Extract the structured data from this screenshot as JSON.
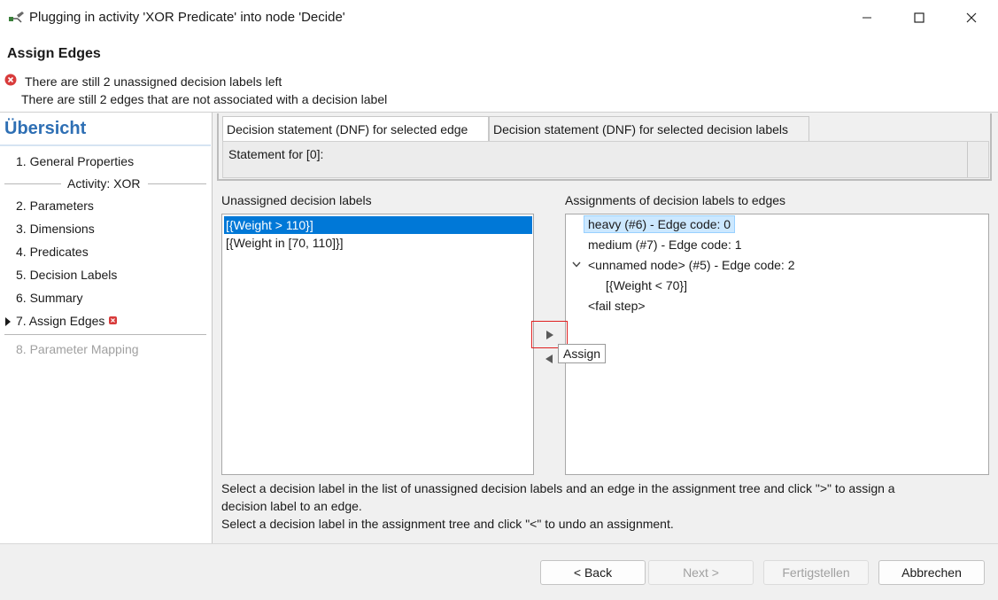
{
  "window": {
    "title": "Plugging in activity 'XOR Predicate' into node 'Decide'",
    "icons": {
      "app": "workflow-plug-icon",
      "minimize": "minimize-icon",
      "maximize": "maximize-icon",
      "close": "close-icon"
    }
  },
  "header": {
    "title": "Assign Edges",
    "messages": [
      "There are still 2 unassigned decision labels left",
      "There are still 2 edges that are not associated with a decision label"
    ],
    "error_color": "#d83b3b"
  },
  "sidebar": {
    "title": "Übersicht",
    "title_color": "#2e6fb4",
    "items": [
      {
        "label": "1. General Properties"
      },
      {
        "label": "2. Parameters"
      },
      {
        "label": "3. Dimensions"
      },
      {
        "label": "4. Predicates"
      },
      {
        "label": "5. Decision Labels"
      },
      {
        "label": "6. Summary"
      },
      {
        "label": "7. Assign Edges",
        "current": true,
        "has_error": true
      },
      {
        "label": "8. Parameter Mapping",
        "disabled": true
      }
    ],
    "group_label": "Activity: XOR"
  },
  "tabs": [
    {
      "label": "Decision statement (DNF) for selected edge",
      "selected": true
    },
    {
      "label": "Decision statement (DNF) for selected decision labels",
      "selected": false
    }
  ],
  "statement": {
    "text": "Statement for [0]:"
  },
  "unassigned": {
    "label": "Unassigned decision labels",
    "items": [
      "[{Weight > 110}]",
      "[{Weight in [70, 110]}]"
    ],
    "selected_index": 0
  },
  "assignments": {
    "label": "Assignments of decision labels to edges",
    "nodes": [
      {
        "text": "heavy (#6) - Edge code: 0",
        "selected": true
      },
      {
        "text": "medium (#7) - Edge code: 1"
      },
      {
        "text": "<unnamed node> (#5) - Edge code: 2",
        "expanded": true
      },
      {
        "text": "[{Weight < 70}]"
      },
      {
        "text": "<fail step>"
      }
    ]
  },
  "assign_buttons": {
    "assign_icon": "arrow-right-icon",
    "unassign_icon": "arrow-left-icon",
    "tooltip": "Assign"
  },
  "help": {
    "line1": "Select a decision label in the list of unassigned decision labels and an edge in the assignment tree and click \">\" to assign a",
    "line2": "decision label to an edge.",
    "line3": "Select a decision label in the assignment tree and click \"<\" to undo an assignment."
  },
  "footer": {
    "back": "< Back",
    "next": "Next >",
    "finish": "Fertigstellen",
    "cancel": "Abbrechen"
  }
}
